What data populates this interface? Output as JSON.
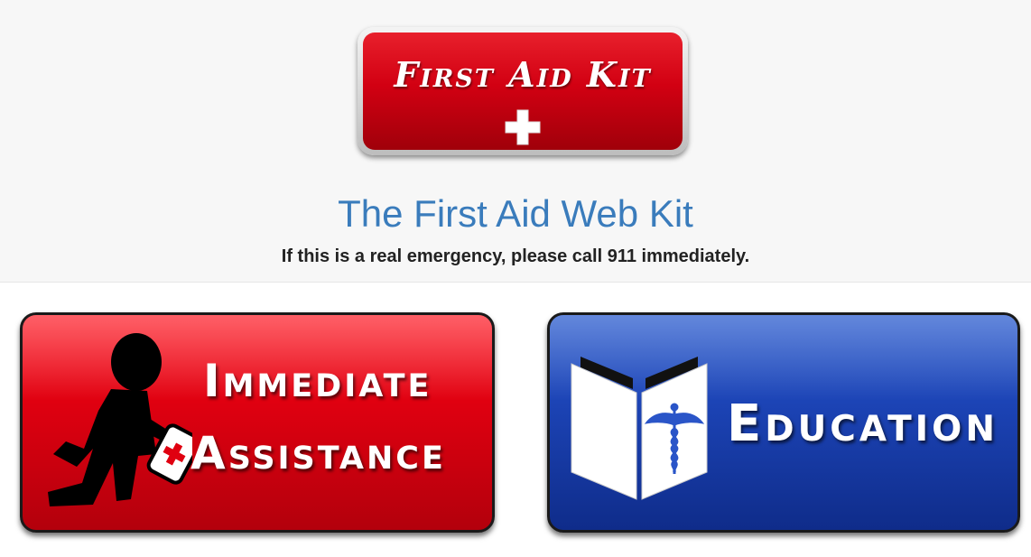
{
  "header": {
    "logo_text": "First Aid Kit",
    "site_title": "The First Aid Web Kit",
    "tagline": "If this is a real emergency, please call 911 immediately."
  },
  "buttons": {
    "immediate": {
      "line1": "Immediate",
      "line2": "Assistance",
      "icon": "person-with-first-aid-kit-icon"
    },
    "education": {
      "label": "Education",
      "icon": "book-caduceus-icon"
    }
  },
  "colors": {
    "brand_red": "#d20012",
    "education_blue": "#1c44b6",
    "title_blue": "#3a7cbc"
  }
}
